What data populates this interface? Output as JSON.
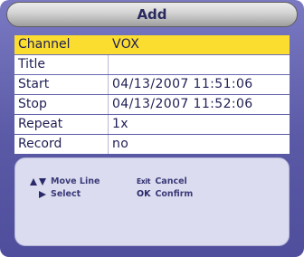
{
  "dialog": {
    "title": "Add"
  },
  "rows": [
    {
      "label": "Channel",
      "value": "VOX",
      "selected": true
    },
    {
      "label": "Title",
      "value": ""
    },
    {
      "label": "Start",
      "value": "04/13/2007 11:51:06"
    },
    {
      "label": "Stop",
      "value": "04/13/2007 11:52:06"
    },
    {
      "label": "Repeat",
      "value": "1x"
    },
    {
      "label": "Record",
      "value": "no"
    }
  ],
  "help": {
    "move_line": "Move Line",
    "select": "Select",
    "exit_key": "Exit",
    "cancel": "Cancel",
    "ok_key": "OK",
    "confirm": "Confirm"
  },
  "colors": {
    "highlight": "#fbdd2f",
    "panel": "#5a59a6",
    "text": "#1e1e55"
  }
}
